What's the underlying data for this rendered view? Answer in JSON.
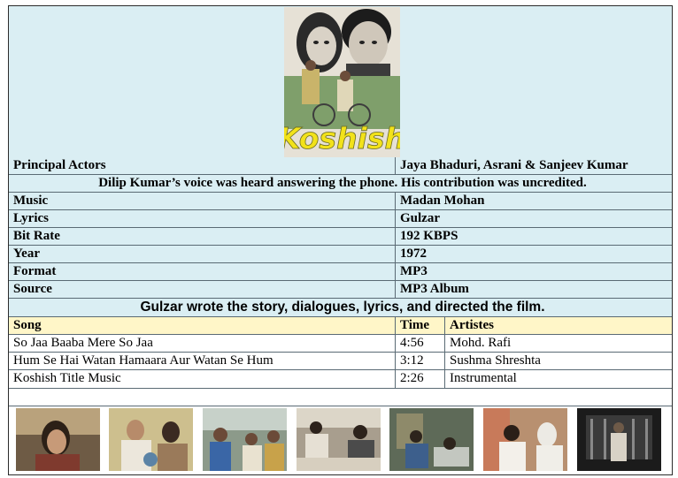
{
  "poster": {
    "title": "Koshish",
    "icon": "movie-poster-image"
  },
  "info_rows": [
    {
      "label": "Principal Actors",
      "value": "Jaya Bhaduri, Asrani & Sanjeev Kumar"
    }
  ],
  "note1": "Dilip Kumar’s voice was heard answering the phone.  His contribution was uncredited.",
  "details": [
    {
      "label": "Music",
      "value": "Madan Mohan"
    },
    {
      "label": "Lyrics",
      "value": "Gulzar"
    },
    {
      "label": "Bit Rate",
      "value": "192 KBPS"
    },
    {
      "label": "Year",
      "value": "1972"
    },
    {
      "label": "Format",
      "value": "MP3"
    },
    {
      "label": "Source",
      "value": "MP3 Album"
    }
  ],
  "note2": "Gulzar wrote the story, dialogues, lyrics, and directed the film.",
  "songs_header": {
    "song": "Song",
    "time": "Time",
    "artistes": "Artistes"
  },
  "songs": [
    {
      "song": "So Jaa Baaba Mere So Jaa",
      "time": "4:56",
      "artistes": "Mohd. Rafi"
    },
    {
      "song": "Hum Se Hai Watan Hamaara Aur Watan Se Hum",
      "time": "3:12",
      "artistes": "Sushma Shreshta"
    },
    {
      "song": "Koshish Title Music",
      "time": "2:26",
      "artistes": "Instrumental"
    }
  ],
  "colors": {
    "row_blue": "#daeef3",
    "header_yellow": "#fff6c8",
    "border": "#5a6a74",
    "poster_title_yellow": "#f2e21a"
  }
}
